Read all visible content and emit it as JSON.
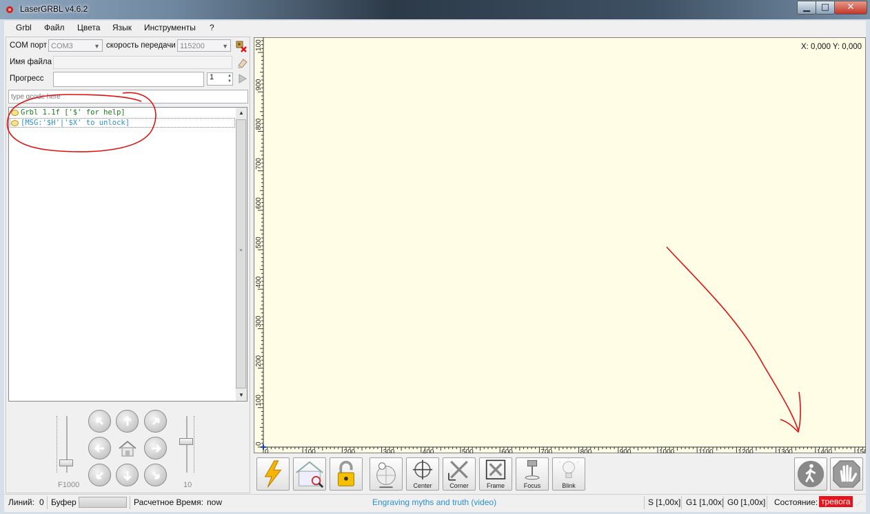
{
  "window": {
    "title": "LaserGRBL v4.6.2",
    "minimize": "▁",
    "maximize": "□",
    "close": "✕"
  },
  "menu": [
    "Grbl",
    "Файл",
    "Цвета",
    "Язык",
    "Инструменты",
    "?"
  ],
  "connection": {
    "port_label": "COM порт",
    "port_value": "COM3",
    "baud_label": "скорость передачи",
    "baud_value": "115200"
  },
  "file": {
    "label": "Имя файла",
    "value": ""
  },
  "progress": {
    "label": "Прогресс",
    "value": 0,
    "passes": "1"
  },
  "gcode_input": {
    "placeholder": "type gcode here"
  },
  "console": {
    "lines": [
      {
        "text": "Grbl 1.1f ['$' for help]",
        "color": "#1a7a1a"
      },
      {
        "text": "[MSG:'$H'|'$X' to unlock]",
        "color": "#2a8fd0"
      }
    ]
  },
  "jog": {
    "feed_label": "F1000",
    "step_label": "10",
    "feed_level": 0.12,
    "step_level": 0.55
  },
  "plot": {
    "coords": "X: 0,000 Y: 0,000",
    "y_ticks": [
      "0",
      "100",
      "200",
      "300",
      "400",
      "500",
      "600",
      "700",
      "800",
      "900",
      "100"
    ],
    "x_ticks": [
      "0",
      "100",
      "200",
      "300",
      "400",
      "500",
      "600",
      "700",
      "800",
      "900",
      "1000",
      "1100",
      "1200",
      "1300",
      "1400",
      "150"
    ]
  },
  "tools": [
    {
      "name": "connect",
      "label": ""
    },
    {
      "name": "homing",
      "label": ""
    },
    {
      "name": "unlock",
      "label": ""
    },
    {
      "name": "go-to-origin",
      "label": ""
    },
    {
      "name": "center",
      "label": "Center"
    },
    {
      "name": "corner",
      "label": "Corner"
    },
    {
      "name": "frame",
      "label": "Frame"
    },
    {
      "name": "focus",
      "label": "Focus"
    },
    {
      "name": "blink",
      "label": "Blink"
    }
  ],
  "status": {
    "lines_label": "Линий:",
    "lines_value": "0",
    "buffer_label": "Буфер",
    "time_label": "Расчетное Время:",
    "time_value": "now",
    "link": "Engraving myths and truth (video)",
    "s": "S [1,00x]",
    "g1": "G1 [1,00x]",
    "g0": "G0 [1,00x]",
    "state_label": "Состояние:",
    "state_value": "тревога",
    "state_color": "#e8121a"
  },
  "colors": {
    "link": "#2a8fd0",
    "annotation": "#e01010",
    "plot_bg": "#fffde6"
  }
}
